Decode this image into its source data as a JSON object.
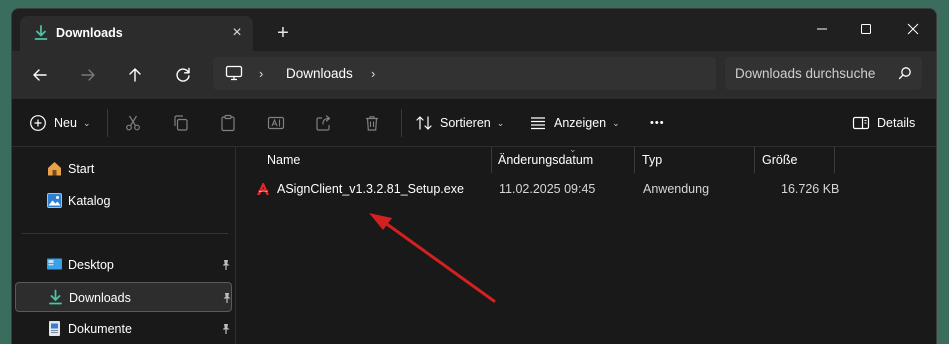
{
  "tab": {
    "title": "Downloads"
  },
  "address": {
    "folder": "Downloads"
  },
  "search": {
    "placeholder": "Downloads durchsuche"
  },
  "toolbar": {
    "new_label": "Neu",
    "sort_label": "Sortieren",
    "view_label": "Anzeigen",
    "more_label": "•••",
    "details_label": "Details"
  },
  "sidebar": {
    "items": [
      {
        "label": "Start",
        "icon": "home-icon"
      },
      {
        "label": "Katalog",
        "icon": "gallery-icon"
      },
      {
        "label": "Desktop",
        "icon": "desktop-icon",
        "pinned": true
      },
      {
        "label": "Downloads",
        "icon": "download-icon",
        "pinned": true,
        "active": true
      },
      {
        "label": "Dokumente",
        "icon": "documents-icon",
        "pinned": true
      }
    ]
  },
  "columns": [
    "Name",
    "Änderungsdatum",
    "Typ",
    "Größe"
  ],
  "files": [
    {
      "name": "ASignClient_v1.3.2.81_Setup.exe",
      "modified": "11.02.2025 09:45",
      "type": "Anwendung",
      "size": "16.726 KB"
    }
  ],
  "colors": {
    "accent": "#4cc2a4",
    "arrow": "#d42020",
    "background": "#191919"
  }
}
